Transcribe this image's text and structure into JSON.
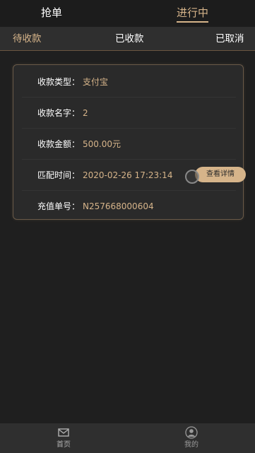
{
  "header": {
    "tabs": [
      {
        "label": "抢单"
      },
      {
        "label": "进行中"
      }
    ]
  },
  "subtabs": [
    {
      "label": "待收款"
    },
    {
      "label": "已收款"
    },
    {
      "label": "已取消"
    }
  ],
  "order": {
    "rows": [
      {
        "label": "收款类型：",
        "value": "支付宝"
      },
      {
        "label": "收款名字：",
        "value": "2"
      },
      {
        "label": "收款金额：",
        "value": "500.00元"
      },
      {
        "label": "匹配时间：",
        "value": "2020-02-26 17:23:14"
      },
      {
        "label": "充值单号：",
        "value": "N257668000604"
      }
    ],
    "detail_button": "查看详情"
  },
  "bottom_nav": [
    {
      "label": "首页",
      "icon": "mail-icon"
    },
    {
      "label": "我的",
      "icon": "user-icon"
    }
  ],
  "colors": {
    "accent": "#d6b48a",
    "background": "#1f1f1f",
    "card": "#2a2a2a"
  }
}
